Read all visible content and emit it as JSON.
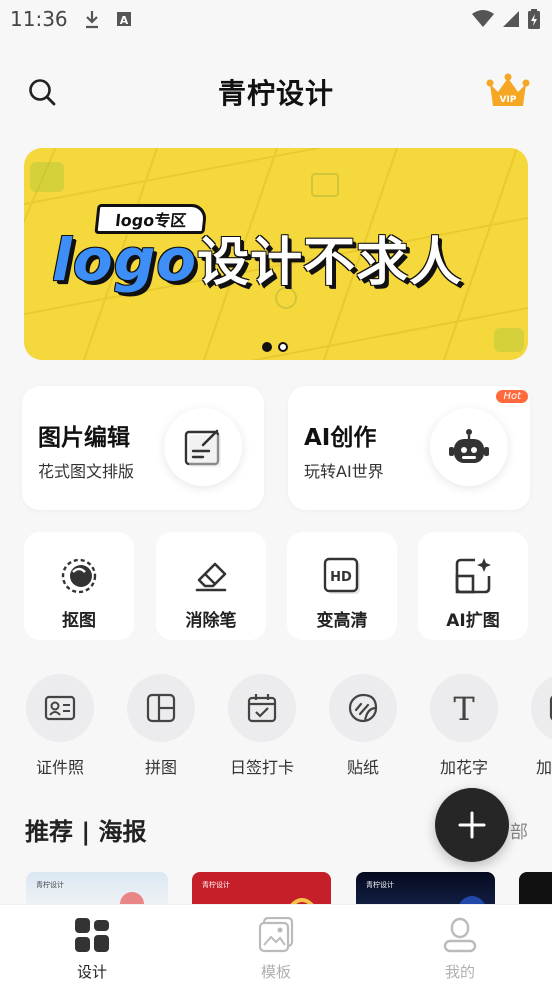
{
  "status_bar": {
    "time": "11:36"
  },
  "header": {
    "title": "青柠设计"
  },
  "banner": {
    "tag": "logo专区",
    "headline_logo": "logo",
    "headline_rest": "设计不求人",
    "slide_count": 2,
    "active_slide": 1
  },
  "features": [
    {
      "title": "图片编辑",
      "subtitle": "花式图文排版",
      "icon": "image-edit-icon"
    },
    {
      "title": "AI创作",
      "subtitle": "玩转AI世界",
      "icon": "robot-icon",
      "badge": "Hot"
    }
  ],
  "tools": [
    {
      "label": "抠图",
      "icon": "cutout-icon"
    },
    {
      "label": "消除笔",
      "icon": "eraser-icon"
    },
    {
      "label": "变高清",
      "icon": "hd-icon"
    },
    {
      "label": "AI扩图",
      "icon": "ai-expand-icon"
    }
  ],
  "quick_actions": [
    {
      "label": "证件照",
      "icon": "id-card-icon"
    },
    {
      "label": "拼图",
      "icon": "collage-icon"
    },
    {
      "label": "日签打卡",
      "icon": "calendar-check-icon"
    },
    {
      "label": "贴纸",
      "icon": "sticker-icon"
    },
    {
      "label": "加花字",
      "icon": "text-icon"
    },
    {
      "label": "加",
      "icon": "more-icon"
    }
  ],
  "section": {
    "title": "推荐 | 海报",
    "more": "部"
  },
  "posters": [
    {
      "brand": "青柠设计"
    },
    {
      "brand": "青柠设计"
    },
    {
      "brand": "青柠设计"
    },
    {
      "brand": ""
    }
  ],
  "bottom_nav": [
    {
      "label": "设计",
      "icon": "design-grid-icon",
      "active": true
    },
    {
      "label": "模板",
      "icon": "template-icon",
      "active": false
    },
    {
      "label": "我的",
      "icon": "profile-icon",
      "active": false
    }
  ],
  "colors": {
    "accent_vip": "#f5a623",
    "banner_bg": "#f5d93c",
    "hot": "#ff6a3d",
    "fab": "#262626"
  }
}
